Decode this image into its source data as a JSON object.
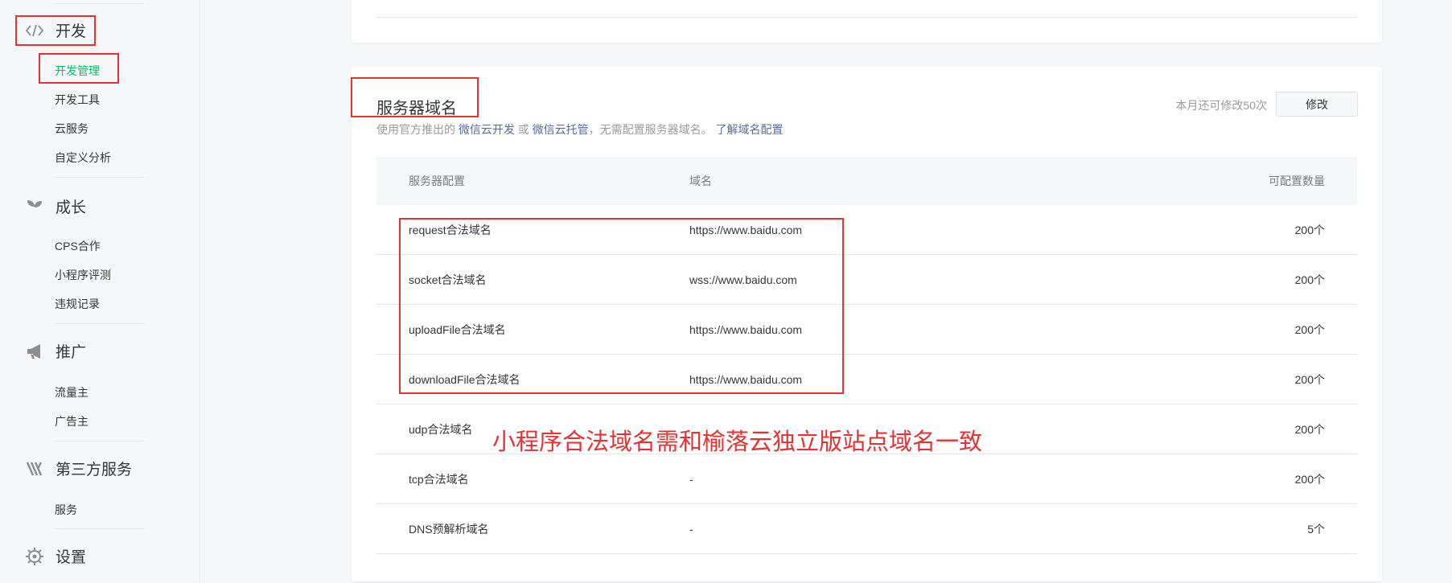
{
  "sidebar": {
    "groups": [
      {
        "label": "开发",
        "icon": "code-icon"
      },
      {
        "label": "成长",
        "icon": "sprout-icon"
      },
      {
        "label": "推广",
        "icon": "megaphone-icon"
      },
      {
        "label": "第三方服务",
        "icon": "third-party-icon"
      },
      {
        "label": "设置",
        "icon": "gear-icon"
      }
    ],
    "dev_items": [
      "开发管理",
      "开发工具",
      "云服务",
      "自定义分析"
    ],
    "growth_items": [
      "CPS合作",
      "小程序评测",
      "违规记录"
    ],
    "promo_items": [
      "流量主",
      "广告主"
    ],
    "third_items": [
      "服务"
    ],
    "active_item": "开发管理",
    "active_color": "#07c160"
  },
  "server_domain": {
    "title": "服务器域名",
    "desc_prefix": "使用官方推出的",
    "link_cloud_dev": "微信云开发",
    "desc_or": "或",
    "link_cloud_host": "微信云托管",
    "desc_suffix": "，无需配置服务器域名。",
    "link_learn": "了解域名配置",
    "quota_text": "本月还可修改50次",
    "modify_button": "修改",
    "columns": [
      "服务器配置",
      "域名",
      "可配置数量"
    ],
    "rows": [
      {
        "config": "request合法域名",
        "domain": "https://www.baidu.com",
        "count": "200个"
      },
      {
        "config": "socket合法域名",
        "domain": "wss://www.baidu.com",
        "count": "200个"
      },
      {
        "config": "uploadFile合法域名",
        "domain": "https://www.baidu.com",
        "count": "200个"
      },
      {
        "config": "downloadFile合法域名",
        "domain": "https://www.baidu.com",
        "count": "200个"
      },
      {
        "config": "udp合法域名",
        "domain": "",
        "count": "200个"
      },
      {
        "config": "tcp合法域名",
        "domain": "-",
        "count": "200个"
      },
      {
        "config": "DNS预解析域名",
        "domain": "-",
        "count": "5个"
      }
    ]
  },
  "annotation": {
    "text": "小程序合法域名需和榆落云独立版站点域名一致",
    "color": "#e53333"
  },
  "link_color": "#576b95"
}
